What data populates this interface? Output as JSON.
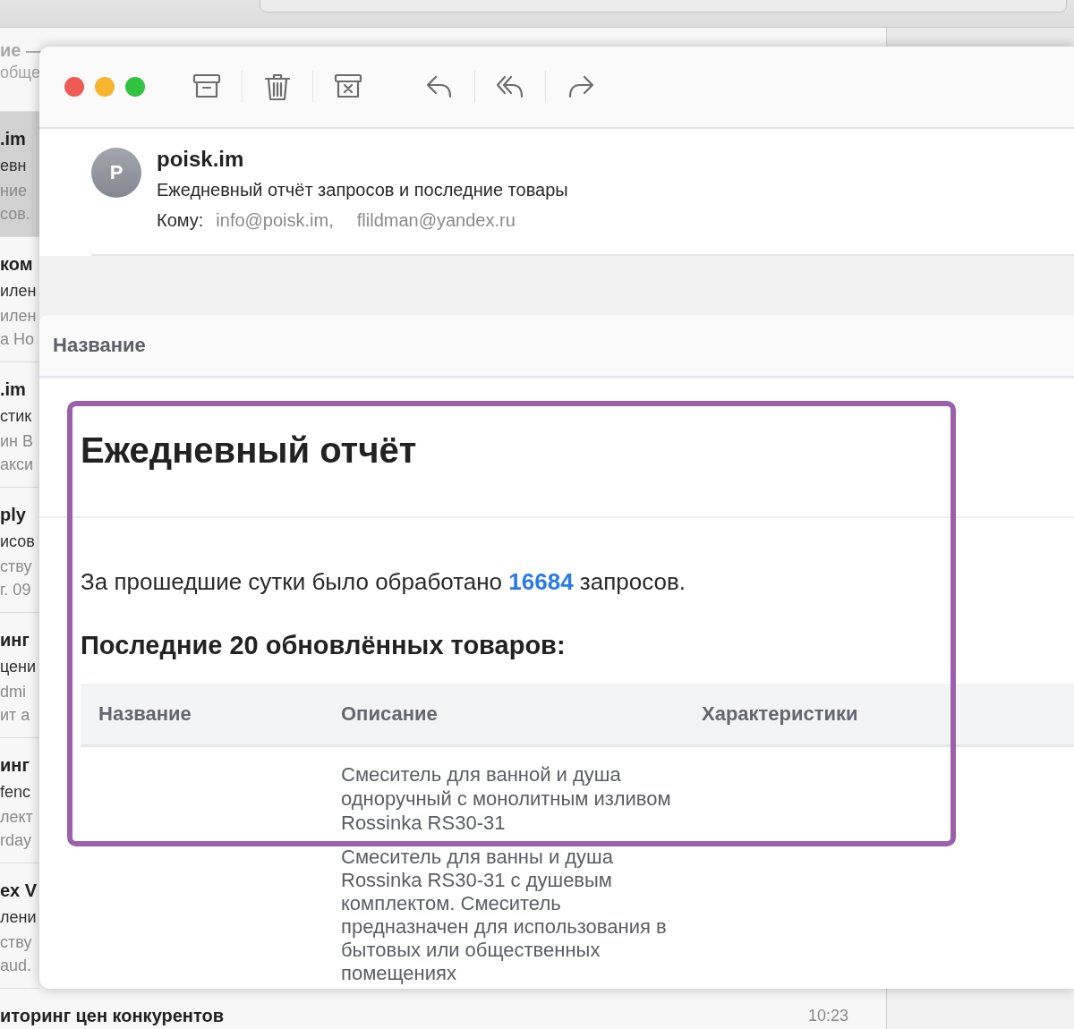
{
  "mailbox": {
    "title": "ие —",
    "subtitle": "обще"
  },
  "messages": [
    {
      "sender": ".im",
      "subject": "евн",
      "preview": [
        "ние",
        "сов."
      ],
      "selected": true
    },
    {
      "sender": "ком",
      "subject": "илен",
      "preview": [
        "илен",
        "а Но"
      ],
      "selected": false
    },
    {
      "sender": ".im",
      "subject": "стик",
      "preview": [
        "ин В",
        "акси"
      ],
      "selected": false
    },
    {
      "sender": "ply",
      "subject": "исов",
      "preview": [
        "ству",
        "г. 09"
      ],
      "selected": false
    },
    {
      "sender": "инг",
      "subject": "цени",
      "preview": [
        "dmi",
        "ит а"
      ],
      "selected": false
    },
    {
      "sender": "инг",
      "subject": "fenc",
      "preview": [
        "лект",
        "rday"
      ],
      "selected": false
    },
    {
      "sender": "ex V",
      "subject": "лени",
      "preview": [
        "ству",
        "aud."
      ],
      "selected": false
    },
    {
      "sender": "иторинг цен конкурентов",
      "time": "10:23",
      "selected": false
    }
  ],
  "message": {
    "sender": {
      "initial": "P",
      "name": "poisk.im"
    },
    "subject": "Ежедневный отчёт запросов и последние товары",
    "to_label": "Кому:",
    "recipients": [
      "info@poisk.im,",
      "flildman@yandex.ru"
    ]
  },
  "email": {
    "header": "Название",
    "title": "Ежедневный отчёт",
    "summary": "За прошедшие сутки было обработано **16684** запросов.",
    "products_heading": "Последние 20 обновлённых товаров:",
    "table": {
      "columns": [
        "Название",
        "Описание",
        "Характеристики"
      ],
      "rows": [
        {
          "description": [
            "Смеситель для ванной и душа одноручный с монолитным изливом Rossinka RS30-31",
            "Смеситель для ванны и душа Rossinka RS30-31 с душевым комплектом. Смеситель предназначен для использования в бытовых или общественных помещениях"
          ]
        }
      ]
    }
  }
}
